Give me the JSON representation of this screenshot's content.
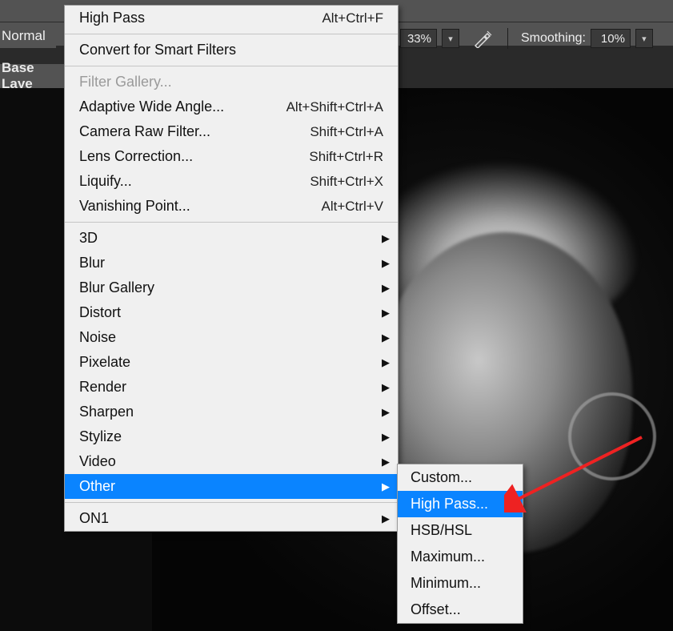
{
  "toolbar": {
    "mode": "Normal",
    "zoom": "33%",
    "smoothing_label": "Smoothing:",
    "smoothing_value": "10%"
  },
  "layer_strip": "Base Laye",
  "filter_menu": {
    "last_filter": {
      "label": "High Pass",
      "shortcut": "Alt+Ctrl+F"
    },
    "convert": "Convert for Smart Filters",
    "group2": [
      {
        "label": "Filter Gallery...",
        "shortcut": "",
        "disabled": true
      },
      {
        "label": "Adaptive Wide Angle...",
        "shortcut": "Alt+Shift+Ctrl+A"
      },
      {
        "label": "Camera Raw Filter...",
        "shortcut": "Shift+Ctrl+A"
      },
      {
        "label": "Lens Correction...",
        "shortcut": "Shift+Ctrl+R"
      },
      {
        "label": "Liquify...",
        "shortcut": "Shift+Ctrl+X"
      },
      {
        "label": "Vanishing Point...",
        "shortcut": "Alt+Ctrl+V"
      }
    ],
    "submenus": [
      "3D",
      "Blur",
      "Blur Gallery",
      "Distort",
      "Noise",
      "Pixelate",
      "Render",
      "Sharpen",
      "Stylize",
      "Video",
      "Other"
    ],
    "on1": "ON1"
  },
  "other_submenu": [
    "Custom...",
    "High Pass...",
    "HSB/HSL",
    "Maximum...",
    "Minimum...",
    "Offset..."
  ]
}
